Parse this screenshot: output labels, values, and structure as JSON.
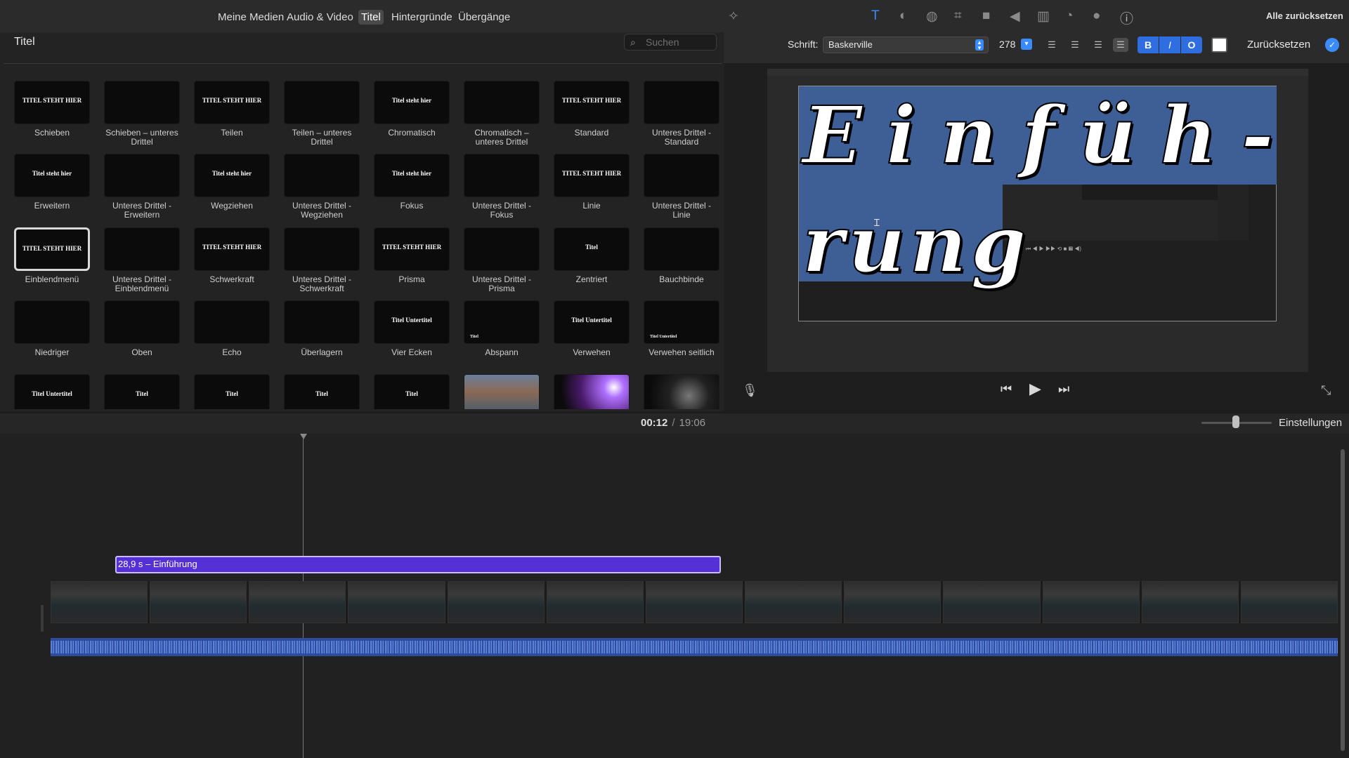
{
  "nav": {
    "tabs": [
      {
        "label": "Meine Medien"
      },
      {
        "label": "Audio & Video"
      },
      {
        "label": "Titel"
      },
      {
        "label": "Hintergründe"
      },
      {
        "label": "Übergänge"
      }
    ],
    "active": "Titel"
  },
  "browser": {
    "title": "Titel",
    "search_placeholder": "Suchen",
    "tiles": [
      {
        "label": "Schieben",
        "preview": "TITEL STEHT HIER"
      },
      {
        "label": "Schieben – unteres Drittel",
        "preview": ""
      },
      {
        "label": "Teilen",
        "preview": "TITEL STEHT HIER"
      },
      {
        "label": "Teilen – unteres Drittel",
        "preview": ""
      },
      {
        "label": "Chromatisch",
        "preview": "Titel steht hier"
      },
      {
        "label": "Chromatisch – unteres Drittel",
        "preview": ""
      },
      {
        "label": "Standard",
        "preview": "TITEL STEHT HIER"
      },
      {
        "label": "Unteres Drittel - Standard",
        "preview": ""
      },
      {
        "label": "Erweitern",
        "preview": "Titel steht hier"
      },
      {
        "label": "Unteres Drittel - Erweitern",
        "preview": ""
      },
      {
        "label": "Wegziehen",
        "preview": "Titel steht hier"
      },
      {
        "label": "Unteres Drittel - Wegziehen",
        "preview": ""
      },
      {
        "label": "Fokus",
        "preview": "Titel steht hier"
      },
      {
        "label": "Unteres Drittel - Fokus",
        "preview": ""
      },
      {
        "label": "Linie",
        "preview": "TITEL STEHT HIER"
      },
      {
        "label": "Unteres Drittel - Linie",
        "preview": ""
      },
      {
        "label": "Einblendmenü",
        "preview": "TITEL STEHT HIER",
        "selected": true
      },
      {
        "label": "Unteres Drittel - Einblendmenü",
        "preview": ""
      },
      {
        "label": "Schwerkraft",
        "preview": "TITEL STEHT HIER"
      },
      {
        "label": "Unteres Drittel - Schwerkraft",
        "preview": ""
      },
      {
        "label": "Prisma",
        "preview": "TITEL STEHT HIER"
      },
      {
        "label": "Unteres Drittel - Prisma",
        "preview": ""
      },
      {
        "label": "Zentriert",
        "preview": "Titel"
      },
      {
        "label": "Bauchbinde",
        "preview": ""
      },
      {
        "label": "Niedriger",
        "preview": ""
      },
      {
        "label": "Oben",
        "preview": ""
      },
      {
        "label": "Echo",
        "preview": ""
      },
      {
        "label": "Überlagern",
        "preview": ""
      },
      {
        "label": "Vier Ecken",
        "preview": "Titel Untertitel"
      },
      {
        "label": "Abspann",
        "preview": "Titel"
      },
      {
        "label": "Verwehen",
        "preview": "Titel Untertitel"
      },
      {
        "label": "Verwehen seitlich",
        "preview": "Titel Untertitel"
      }
    ],
    "partial_row": [
      {
        "preview": "Titel Untertitel"
      },
      {
        "preview": "Titel"
      },
      {
        "preview": "Titel"
      },
      {
        "preview": "Titel"
      },
      {
        "preview": "Titel"
      },
      {
        "preview": ""
      },
      {
        "preview": ""
      },
      {
        "preview": ""
      }
    ]
  },
  "toolbar": {
    "reset_all": "Alle zurücksetzen",
    "icons": [
      "magic-wand-icon",
      "text-icon",
      "color-balance-icon",
      "color-correction-icon",
      "crop-icon",
      "camera-stabilization-icon",
      "volume-icon",
      "equalizer-icon",
      "speed-icon",
      "noise-reduction-icon",
      "info-icon"
    ]
  },
  "fontbar": {
    "label": "Schrift:",
    "font": "Baskerville",
    "size": "278",
    "bold": "B",
    "italic": "I",
    "outline": "O",
    "reset": "Zurücksetzen",
    "text_color": "#ffffff"
  },
  "viewer": {
    "line1": "Einfüh-",
    "line2": "rung",
    "overlay_color": "#3d5f96"
  },
  "timeline": {
    "current_time": "00:12",
    "total_time": "19:06",
    "settings_label": "Einstellungen",
    "title_clip": "28,9 s – Einführung",
    "clip_color": "#5430d6",
    "audio_color": "#2d4c9c"
  }
}
